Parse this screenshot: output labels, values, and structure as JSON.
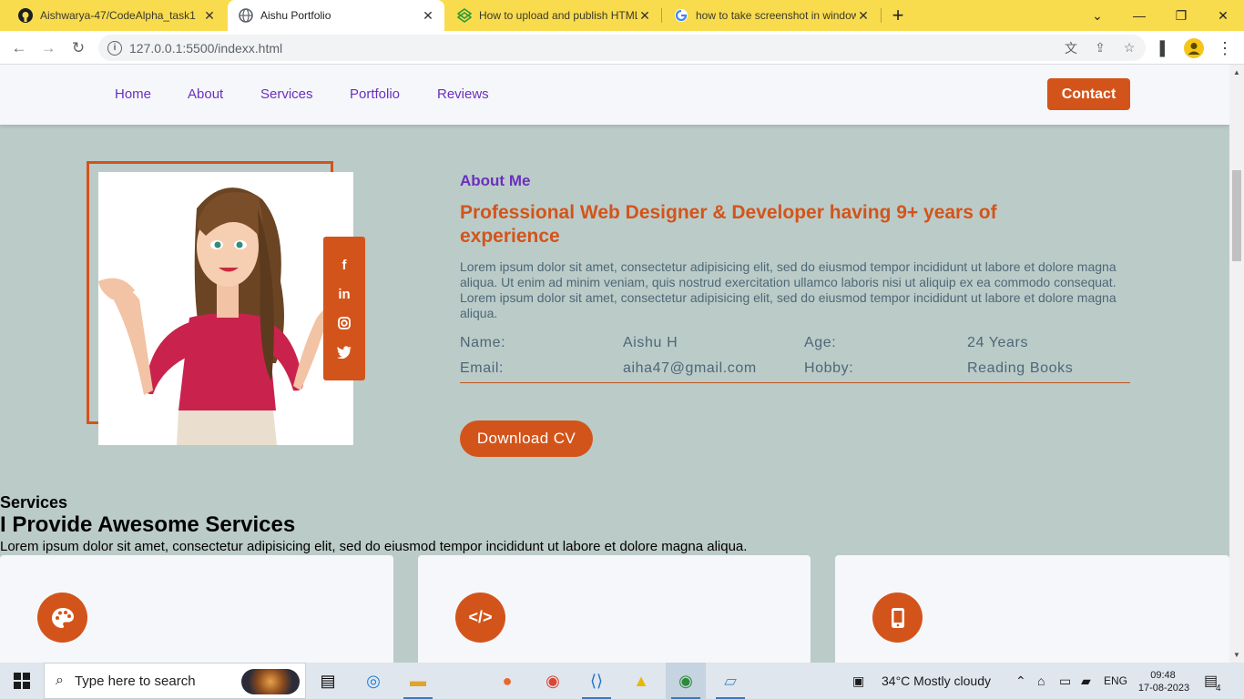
{
  "browser": {
    "tabs": [
      {
        "title": "Aishwarya-47/CodeAlpha_task1",
        "icon": "github-icon",
        "active": false
      },
      {
        "title": "Aishu Portfolio",
        "icon": "globe-icon",
        "active": true
      },
      {
        "title": "How to upload and publish HTML",
        "icon": "codepen-icon",
        "active": false
      },
      {
        "title": "how to take screenshot in windows",
        "icon": "google-icon",
        "active": false
      }
    ],
    "url": "127.0.0.1:5500/indexx.html"
  },
  "site": {
    "nav": [
      "Home",
      "About",
      "Services",
      "Portfolio",
      "Reviews"
    ],
    "contact_label": "Contact",
    "about": {
      "kicker": "About Me",
      "heading": "Professional Web Designer & Developer having 9+ years of experience",
      "p1": "Lorem ipsum dolor sit amet, consectetur adipisicing elit, sed do eiusmod tempor incididunt ut labore et dolore magna aliqua. Ut enim ad minim veniam, quis nostrud exercitation ullamco laboris nisi ut aliquip ex ea commodo consequat.",
      "p2": "Lorem ipsum dolor sit amet, consectetur adipisicing elit, sed do eiusmod tempor incididunt ut labore et dolore magna aliqua.",
      "info": {
        "name_label": "Name:",
        "name_value": "Aishu H",
        "age_label": "Age:",
        "age_value": "24 Years",
        "email_label": "Email:",
        "email_value": "aiha47@gmail.com",
        "hobby_label": "Hobby:",
        "hobby_value": "Reading Books"
      },
      "cv_label": "Download CV",
      "social": [
        "facebook-icon",
        "linkedin-icon",
        "instagram-icon",
        "twitter-icon"
      ]
    },
    "services": {
      "title": "Services",
      "heading": "I Provide Awesome Services",
      "desc": "Lorem ipsum dolor sit amet, consectetur adipisicing elit, sed do eiusmod tempor incididunt ut labore et dolore magna aliqua.",
      "cards": [
        {
          "icon": "palette-icon",
          "glyph": "🎨"
        },
        {
          "icon": "code-icon",
          "glyph": "</>"
        },
        {
          "icon": "mobile-icon",
          "glyph": "▯"
        }
      ]
    }
  },
  "taskbar": {
    "search_placeholder": "Type here to search",
    "weather": "34°C  Mostly cloudy",
    "lang": "ENG",
    "time": "09:48",
    "date": "17-08-2023",
    "notifications": "4"
  },
  "colors": {
    "accent": "#d3541a",
    "purple": "#6b2fbf",
    "page_bg": "#bbcbc8",
    "tabbar": "#f9db4e"
  }
}
